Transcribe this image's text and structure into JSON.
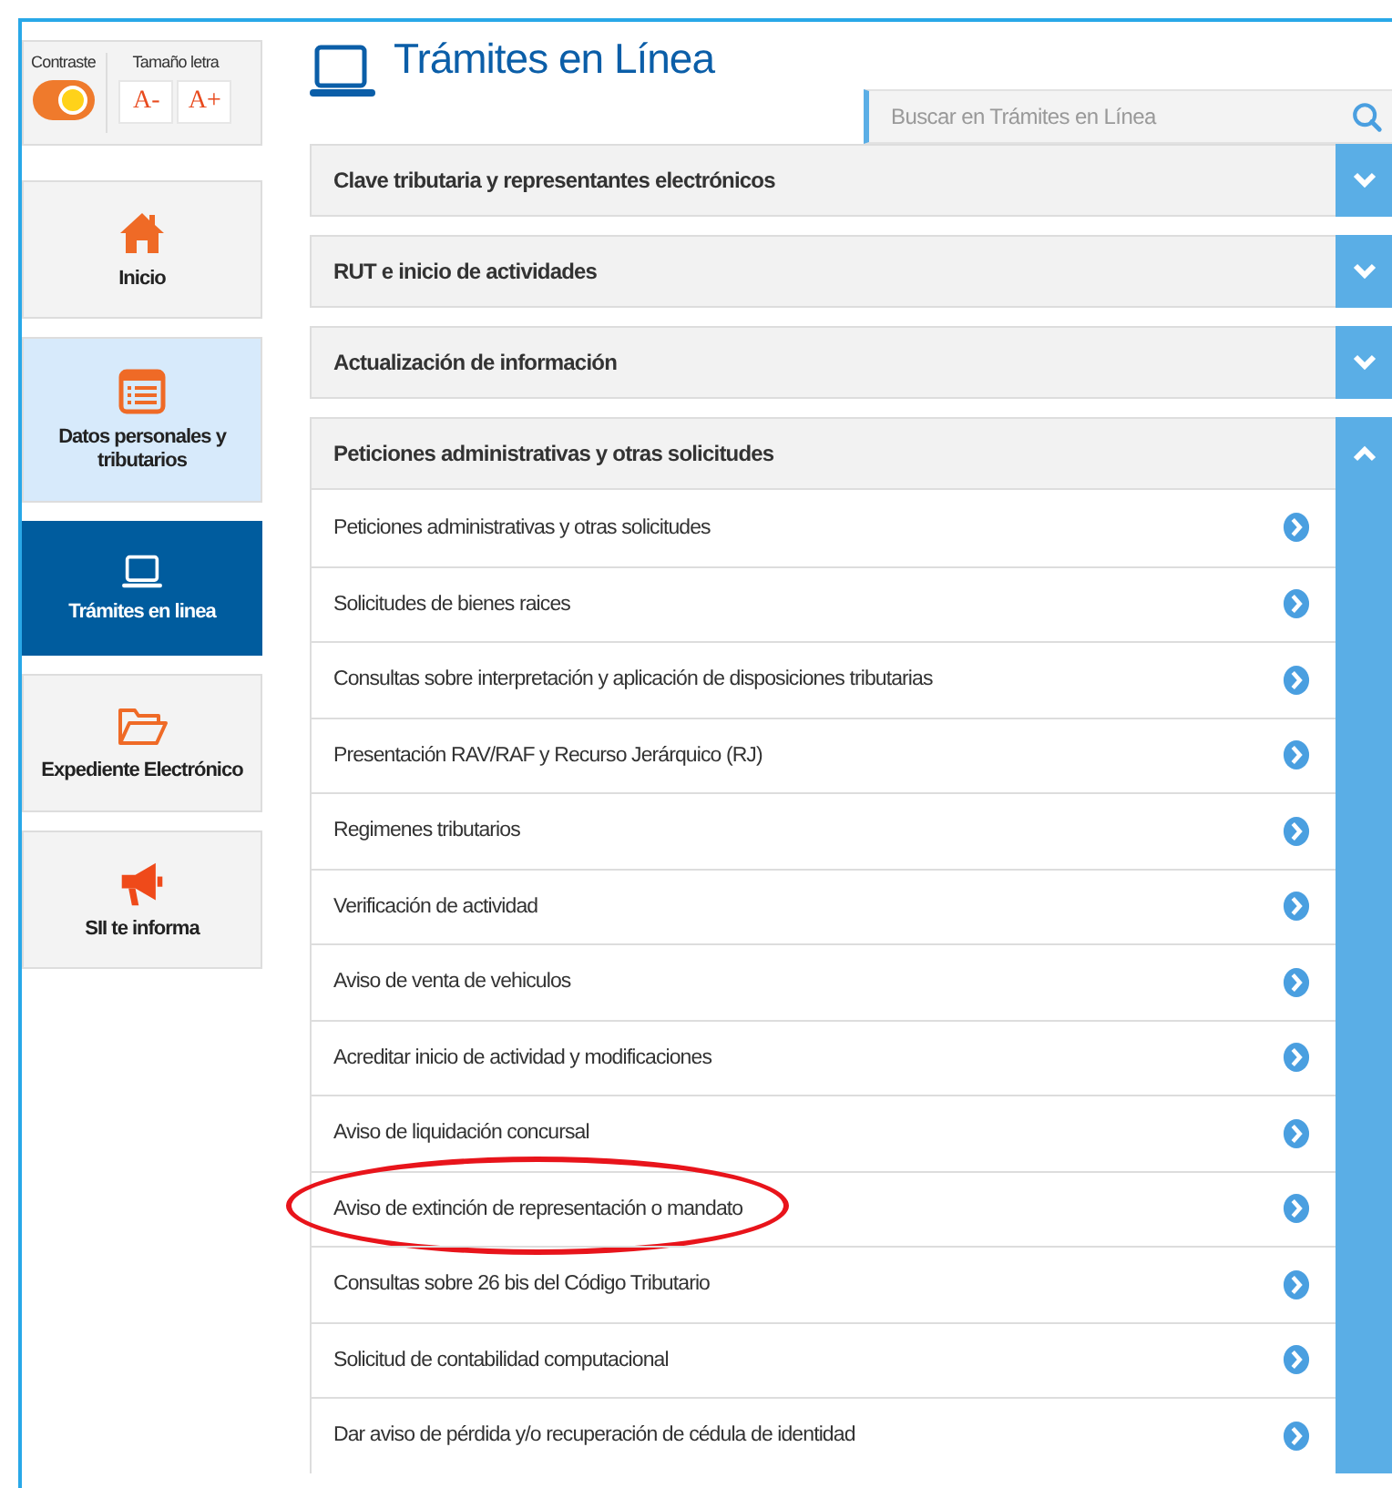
{
  "accessibility": {
    "contrast_label": "Contraste",
    "contrast_on": true,
    "font_size_label": "Tamaño letra",
    "font_buttons": [
      "A-",
      "A+"
    ]
  },
  "sidebar": {
    "items": [
      {
        "label": "Inicio",
        "kind": "home",
        "selected": false,
        "highlighted": false
      },
      {
        "label": "Datos personales y tributarios",
        "kind": "list",
        "selected": false,
        "highlighted": true
      },
      {
        "label": "Trámites en linea",
        "kind": "laptop",
        "selected": true,
        "highlighted": false
      },
      {
        "label": "Expediente Electrónico",
        "kind": "folder",
        "selected": false,
        "highlighted": false
      },
      {
        "label": "SII te informa",
        "kind": "megaphone",
        "selected": false,
        "highlighted": false
      }
    ]
  },
  "page_title": "Trámites en Línea",
  "search": {
    "placeholder": "Buscar en Trámites en Línea"
  },
  "sections": [
    {
      "title": "Clave tributaria y representantes electrónicos",
      "expanded": false
    },
    {
      "title": "RUT e inicio de actividades",
      "expanded": false
    },
    {
      "title": "Actualización de información",
      "expanded": false
    },
    {
      "title": "Peticiones administrativas y otras solicitudes",
      "expanded": true,
      "items": [
        {
          "label": "Peticiones administrativas y otras solicitudes",
          "circled": false
        },
        {
          "label": "Solicitudes de bienes raices",
          "circled": false
        },
        {
          "label": "Consultas sobre interpretación y aplicación de disposiciones tributarias",
          "circled": false
        },
        {
          "label": "Presentación RAV/RAF y Recurso Jerárquico (RJ)",
          "circled": false
        },
        {
          "label": "Regimenes tributarios",
          "circled": false
        },
        {
          "label": "Verificación de actividad",
          "circled": false
        },
        {
          "label": "Aviso de venta de vehiculos",
          "circled": false
        },
        {
          "label": "Acreditar inicio de actividad y modificaciones",
          "circled": false
        },
        {
          "label": "Aviso de liquidación concursal",
          "circled": false
        },
        {
          "label": "Aviso de extinción de representación o mandato",
          "circled": true
        },
        {
          "label": "Consultas sobre 26 bis del Código Tributario",
          "circled": false
        },
        {
          "label": "Solicitud de contabilidad computacional",
          "circled": false
        },
        {
          "label": "Dar aviso de pérdida y/o recuperación de cédula de identidad",
          "circled": false
        }
      ]
    }
  ]
}
